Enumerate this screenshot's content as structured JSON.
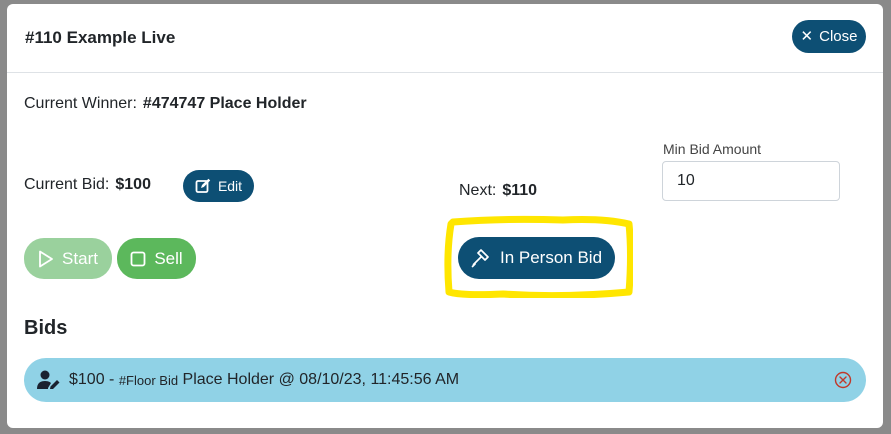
{
  "header": {
    "title": "#110 Example Live",
    "close_label": "Close"
  },
  "winner": {
    "label": "Current Winner:",
    "value": "#474747 Place Holder"
  },
  "current_bid": {
    "label": "Current Bid:",
    "value": "$100",
    "edit_label": "Edit"
  },
  "next": {
    "label": "Next:",
    "value": "$110"
  },
  "min_bid": {
    "label": "Min Bid Amount",
    "value": "10"
  },
  "actions": {
    "start_label": "Start",
    "sell_label": "Sell",
    "in_person_label": "In Person Bid"
  },
  "bids": {
    "heading": "Bids",
    "items": [
      {
        "amount": "$100 -",
        "tag": "#Floor Bid",
        "detail": "Place Holder @ 08/10/23, 11:45:56 AM"
      }
    ]
  },
  "colors": {
    "primary": "#0d4f74",
    "success": "#5cb85c",
    "success_disabled": "#9ad19d",
    "bid_item_bg": "#90d2e6",
    "highlight": "#ffe600",
    "remove_icon": "#c0392b"
  },
  "icons": {
    "close": "close-icon",
    "edit": "edit-icon",
    "start": "play-icon",
    "sell": "square-icon",
    "in_person": "gavel-icon",
    "bidder": "user-edit-icon",
    "remove": "remove-circle-icon"
  }
}
